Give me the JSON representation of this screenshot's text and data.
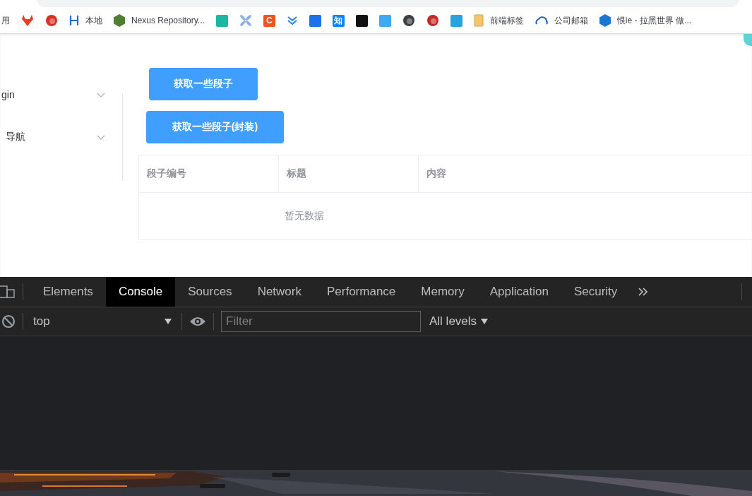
{
  "bookmarks": [
    {
      "kind": "text",
      "label": "用"
    },
    {
      "kind": "fox",
      "color": "#e24329"
    },
    {
      "kind": "circle",
      "color": "#d93025"
    },
    {
      "kind": "letter",
      "color": "#1e6fd9",
      "label": "本地"
    },
    {
      "kind": "hexagon",
      "color": "#4e7d34",
      "label": "Nexus Repository..."
    },
    {
      "kind": "tile",
      "color": "#1fb5a5"
    },
    {
      "kind": "pinwheel",
      "color": "#8fb3e0"
    },
    {
      "kind": "tile",
      "color": "#f4511e",
      "glyph": "C"
    },
    {
      "kind": "chevrons",
      "color": "#1e88e5"
    },
    {
      "kind": "tile",
      "color": "#1a73e8"
    },
    {
      "kind": "tile",
      "color": "#0a84ff",
      "glyph": "知"
    },
    {
      "kind": "tile",
      "color": "#111111"
    },
    {
      "kind": "tile",
      "color": "#3fa9f5"
    },
    {
      "kind": "circle",
      "color": "#3c4043"
    },
    {
      "kind": "circle",
      "color": "#c62828"
    },
    {
      "kind": "tile",
      "color": "#29a3e0"
    },
    {
      "kind": "folder",
      "color": "#f5c46b",
      "label": "前端标签"
    },
    {
      "kind": "cloud",
      "color": "#1565c0",
      "label": "公司邮箱"
    },
    {
      "kind": "hexagon",
      "color": "#1976d2",
      "label": "恨ie - 拉黑世界 做..."
    }
  ],
  "sidebar": {
    "items": [
      {
        "label": "gin"
      },
      {
        "label": "导航"
      }
    ]
  },
  "buttons": [
    "获取一些段子",
    "获取一些段子(封装)"
  ],
  "table": {
    "columns": [
      "段子编号",
      "标题",
      "内容"
    ],
    "empty_text": "暂无数据"
  },
  "devtools": {
    "tabs": [
      {
        "label": "Elements",
        "selected": false
      },
      {
        "label": "Console",
        "selected": true
      },
      {
        "label": "Sources",
        "selected": false
      },
      {
        "label": "Network",
        "selected": false
      },
      {
        "label": "Performance",
        "selected": false
      },
      {
        "label": "Memory",
        "selected": false
      },
      {
        "label": "Application",
        "selected": false
      },
      {
        "label": "Security",
        "selected": false
      }
    ],
    "context": "top",
    "filter": {
      "placeholder": "Filter"
    },
    "levels": "All levels"
  }
}
